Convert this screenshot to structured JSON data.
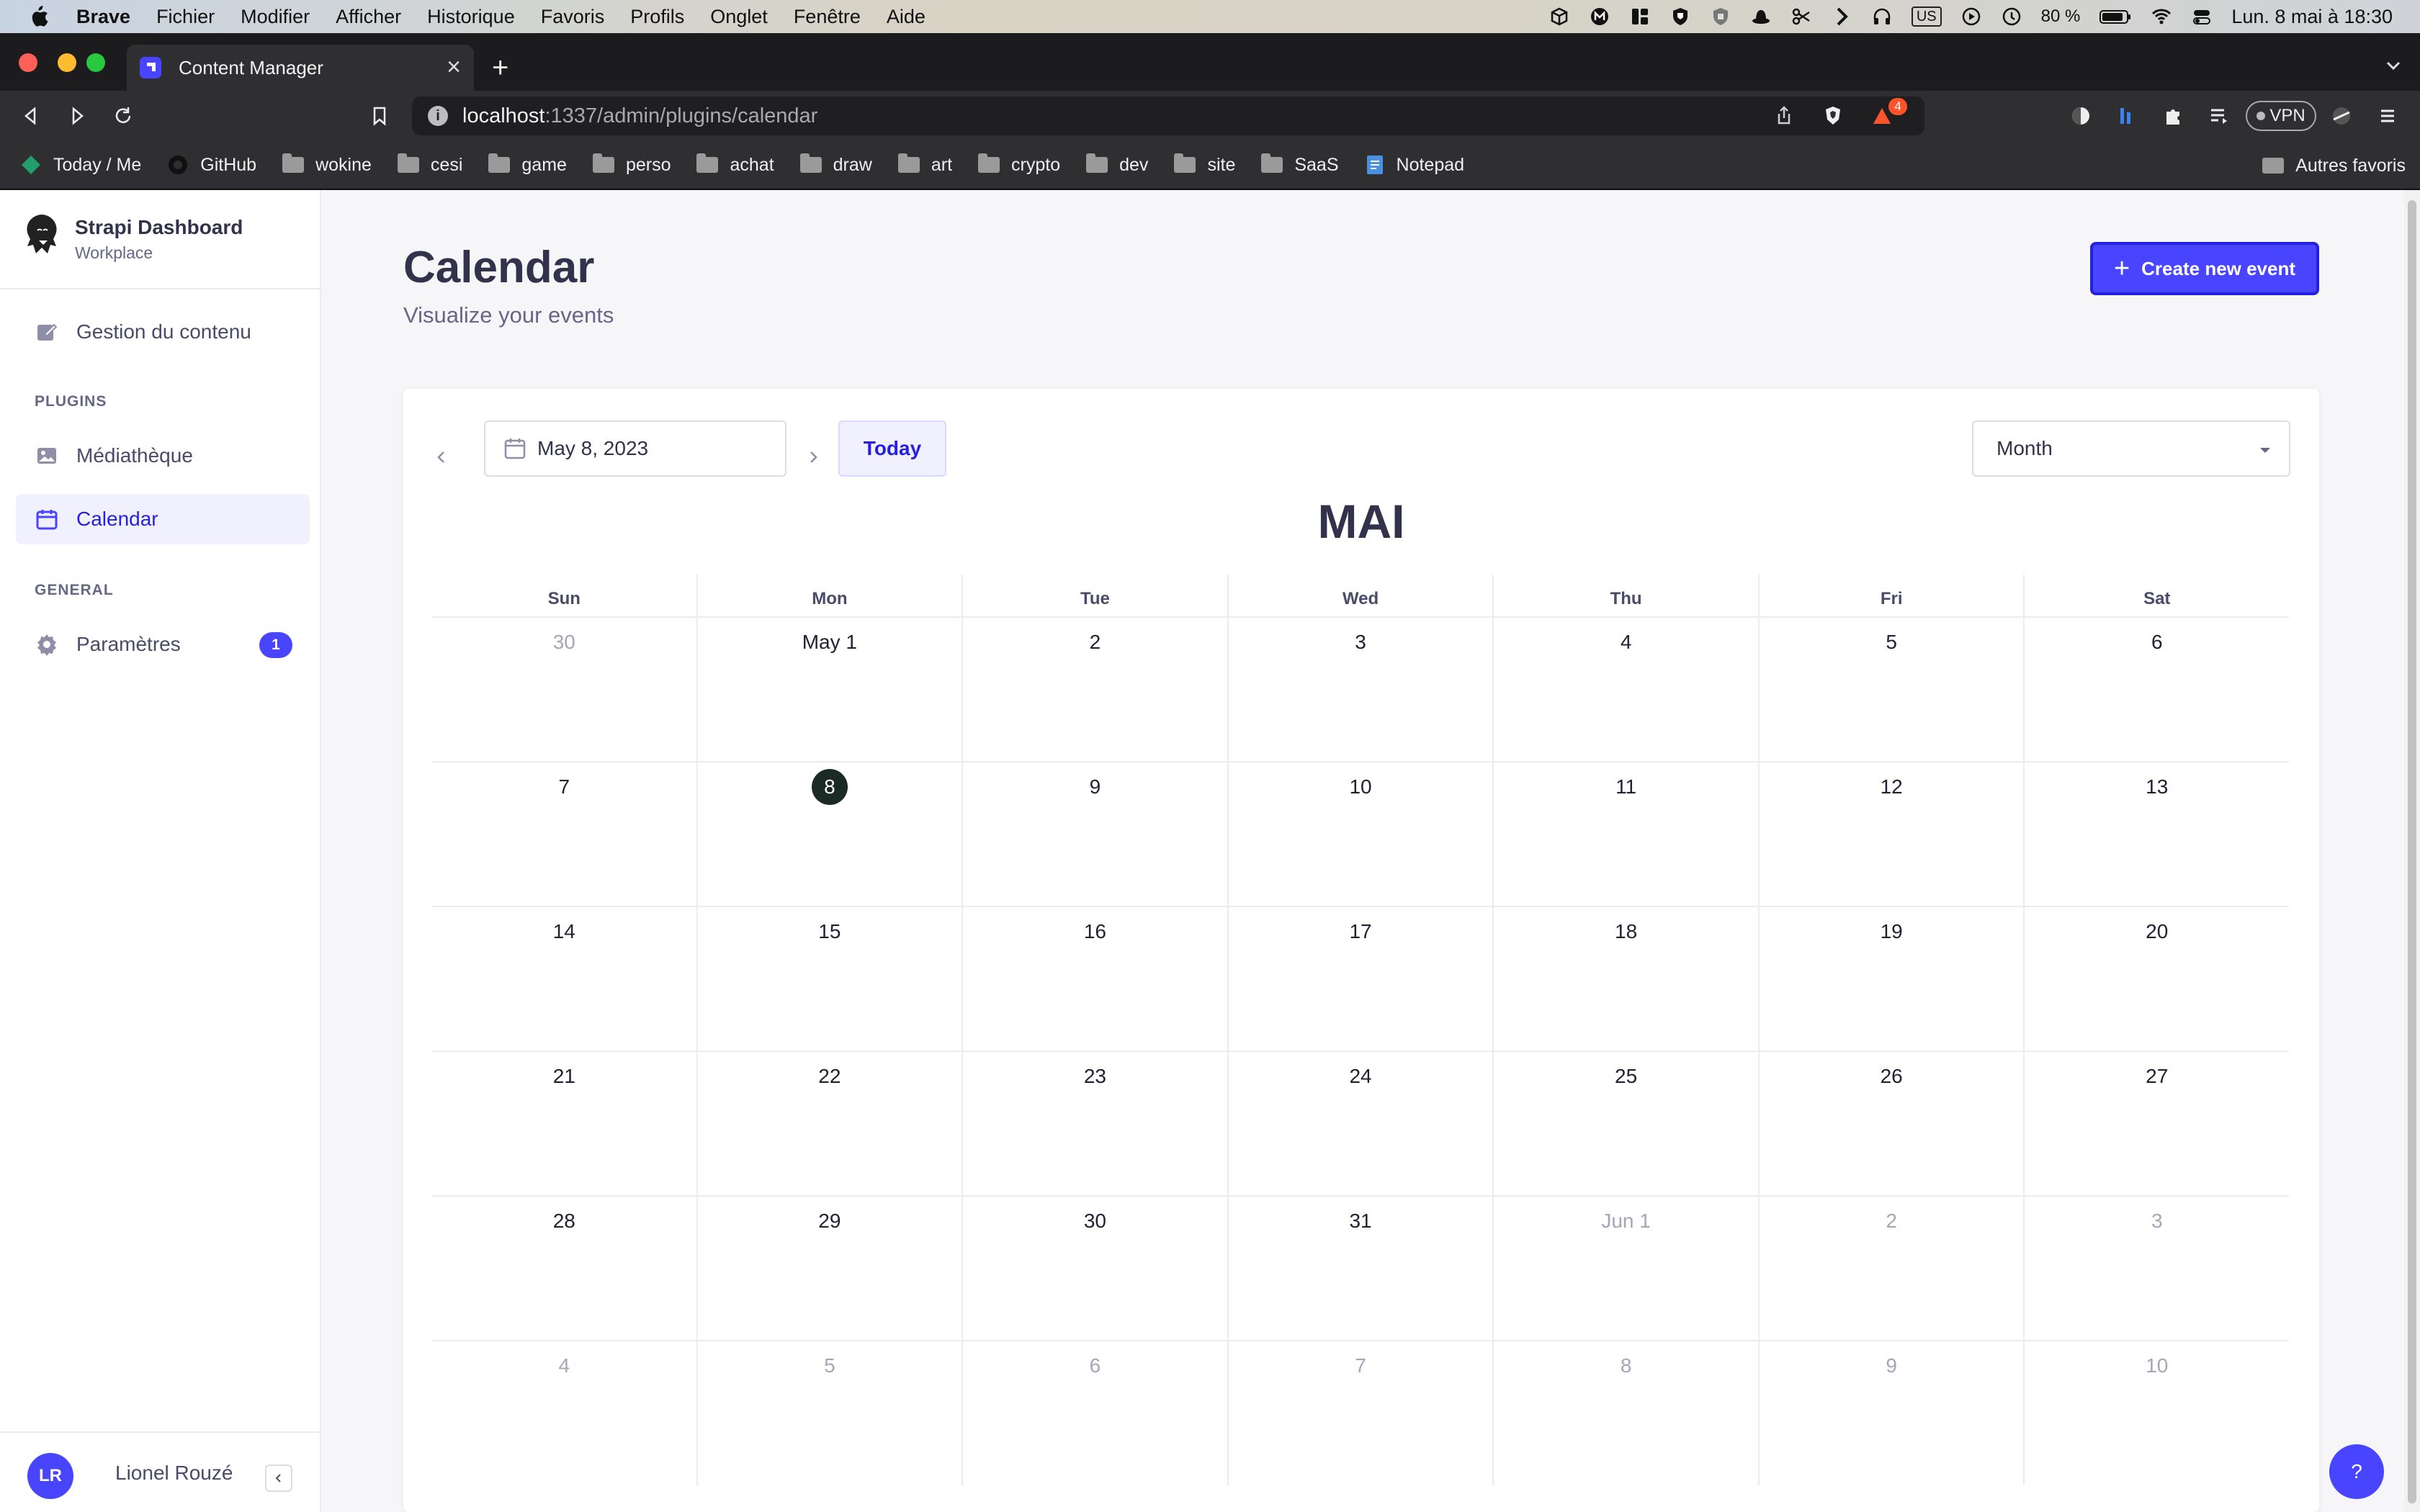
{
  "menubar": {
    "items": [
      "Brave",
      "Fichier",
      "Modifier",
      "Afficher",
      "Historique",
      "Favoris",
      "Profils",
      "Onglet",
      "Fenêtre",
      "Aide"
    ],
    "keyboard": "US",
    "battery": "80 %",
    "clock": "Lun. 8 mai à 18:30"
  },
  "browser": {
    "tab_title": "Content Manager",
    "url_host": "localhost",
    "url_path": ":1337/admin/plugins/calendar",
    "brave_badge": "4",
    "vpn_label": "VPN",
    "bookmarks": [
      "Today / Me",
      "GitHub",
      "wokine",
      "cesi",
      "game",
      "perso",
      "achat",
      "draw",
      "art",
      "crypto",
      "dev",
      "site",
      "SaaS",
      "Notepad"
    ],
    "other_bookmarks": "Autres favoris"
  },
  "sidebar": {
    "brand_title": "Strapi Dashboard",
    "brand_sub": "Workplace",
    "content_manager": "Gestion du contenu",
    "plugins_section": "PLUGINS",
    "media_library": "Médiathèque",
    "calendar": "Calendar",
    "general_section": "GENERAL",
    "settings": "Paramètres",
    "settings_badge": "1",
    "user_initials": "LR",
    "user_name": "Lionel Rouzé"
  },
  "header": {
    "title": "Calendar",
    "subtitle": "Visualize your events",
    "create_button": "Create new event"
  },
  "calendar": {
    "selected_date": "May 8, 2023",
    "today_button": "Today",
    "view_mode": "Month",
    "month_title": "MAI",
    "weekdays": [
      "Sun",
      "Mon",
      "Tue",
      "Wed",
      "Thu",
      "Fri",
      "Sat"
    ],
    "weeks": [
      [
        "30",
        "May 1",
        "2",
        "3",
        "4",
        "5",
        "6"
      ],
      [
        "7",
        "8",
        "9",
        "10",
        "11",
        "12",
        "13"
      ],
      [
        "14",
        "15",
        "16",
        "17",
        "18",
        "19",
        "20"
      ],
      [
        "21",
        "22",
        "23",
        "24",
        "25",
        "26",
        "27"
      ],
      [
        "28",
        "29",
        "30",
        "31",
        "Jun 1",
        "2",
        "3"
      ],
      [
        "4",
        "5",
        "6",
        "7",
        "8",
        "9",
        "10"
      ]
    ],
    "today_label": "8"
  },
  "help_label": "?",
  "colors": {
    "primary": "#4945ff",
    "today_marker": "#1b2a24",
    "muted_day": "#a5a5ba"
  }
}
